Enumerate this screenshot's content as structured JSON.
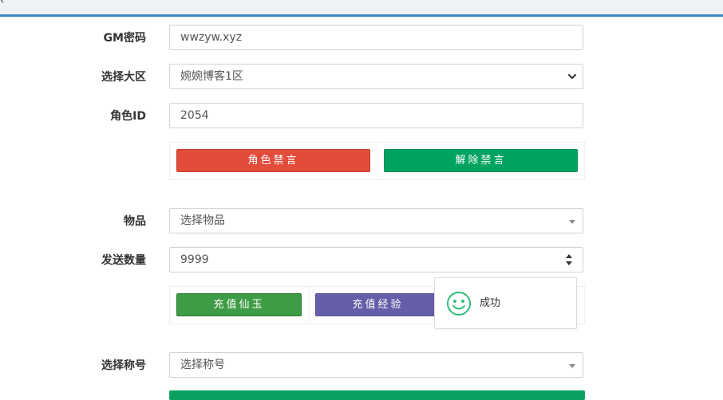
{
  "form": {
    "gm_password": {
      "label": "GM密码",
      "value": "wwzyw.xyz"
    },
    "server": {
      "label": "选择大区",
      "value": "婉婉博客1区"
    },
    "role_id": {
      "label": "角色ID",
      "value": "2054"
    },
    "ban_buttons": {
      "mute": "角色禁言",
      "unmute": "解除禁言"
    },
    "item": {
      "label": "物品",
      "value": "选择物品"
    },
    "quantity": {
      "label": "发送数量",
      "value": "9999"
    },
    "recharge_buttons": {
      "jade": "充值仙玉",
      "exp": "充值经验"
    },
    "title": {
      "label": "选择称号",
      "value": "选择称号"
    }
  },
  "toast": {
    "message": "成功",
    "icon": "smile-icon"
  },
  "icons": {
    "back": "chevron-left-icon",
    "select_chevron": "chevron-down-icon",
    "dropdown_caret": "caret-down-icon",
    "number_spinner": "spinner-icon"
  },
  "colors": {
    "accent": "#3f87c6",
    "danger": "#e24c3b",
    "success": "#00a35f",
    "success_alt": "#3f9c46",
    "purple": "#655ea8",
    "toast_icon": "#2fbf77"
  }
}
